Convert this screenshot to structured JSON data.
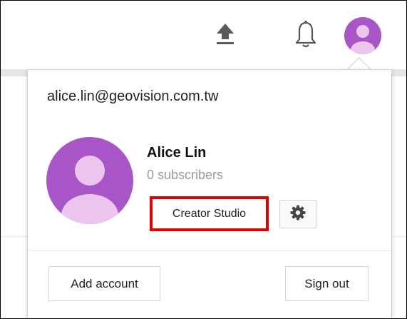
{
  "topbar": {
    "icons": [
      "upload-icon",
      "bell-icon",
      "avatar-icon"
    ]
  },
  "account_menu": {
    "email": "alice.lin@geovision.com.tw",
    "name": "Alice Lin",
    "subscribers": "0 subscribers",
    "creator_studio_label": "Creator Studio",
    "settings_icon": "gear-icon",
    "add_account_label": "Add account",
    "sign_out_label": "Sign out",
    "highlight_color": "#e00000",
    "avatar_color": "#a855c8",
    "avatar_figure_color": "#ecc5ee"
  }
}
